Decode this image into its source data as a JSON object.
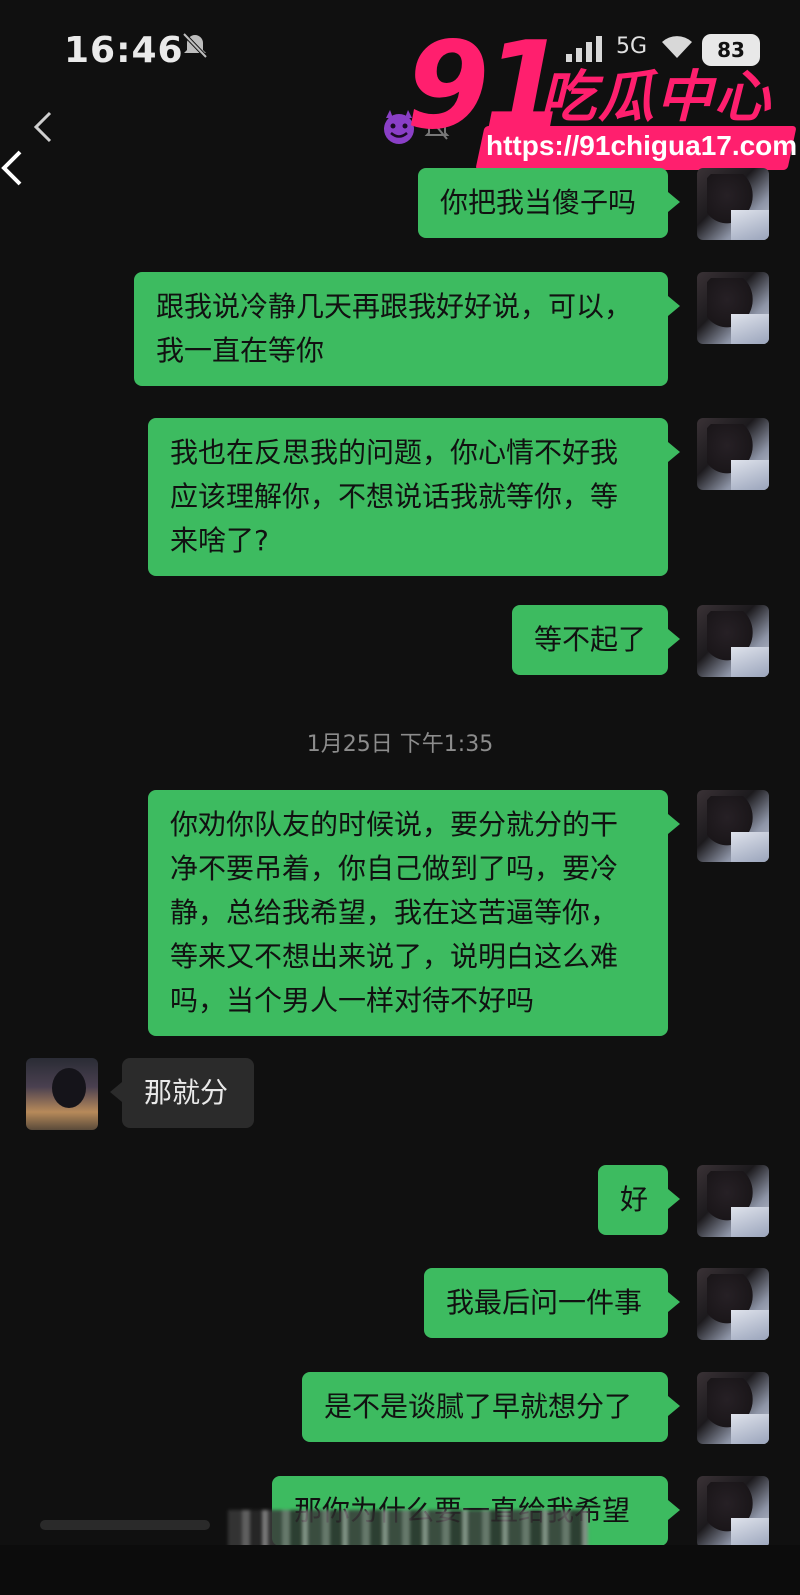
{
  "status_bar": {
    "time": "16:46",
    "network": "5G",
    "battery": "83"
  },
  "watermark": {
    "brand_number": "91",
    "brand_name": "吃瓜中心",
    "url": "https://91chigua17.com",
    "color": "#ff1f6e"
  },
  "header": {
    "back_icon": "chevron-left-icon",
    "title_emoji_icon": "smiling-devil-icon",
    "mute_icon": "bell-muted-icon"
  },
  "colors": {
    "background": "#101010",
    "my_bubble": "#3dbb60",
    "their_bubble": "#2b2b2b",
    "timestamp": "#8c8c8c"
  },
  "messages": [
    {
      "from": "me",
      "text": "你把我当傻子吗"
    },
    {
      "from": "me",
      "lines": [
        "跟我说冷静几天再跟我好好说，可以，",
        "我一直在等你"
      ]
    },
    {
      "from": "me",
      "lines": [
        "我也在反思我的问题，你心情不好我",
        "应该理解你，不想说话我就等你，等",
        "来啥了?"
      ]
    },
    {
      "from": "me",
      "text": "等不起了"
    },
    {
      "type": "timestamp",
      "text": "1月25日 下午1:35"
    },
    {
      "from": "me",
      "lines": [
        "你劝你队友的时候说，要分就分的干",
        "净不要吊着，你自己做到了吗，要冷",
        "静，总给我希望，我在这苦逼等你，",
        "等来又不想出来说了，说明白这么难",
        "吗，当个男人一样对待不好吗"
      ]
    },
    {
      "from": "them",
      "text": "那就分"
    },
    {
      "from": "me",
      "text": "好"
    },
    {
      "from": "me",
      "text": "我最后问一件事"
    },
    {
      "from": "me",
      "text": "是不是谈腻了早就想分了"
    },
    {
      "from": "me",
      "text": "那你为什么要一直给我希望"
    }
  ]
}
